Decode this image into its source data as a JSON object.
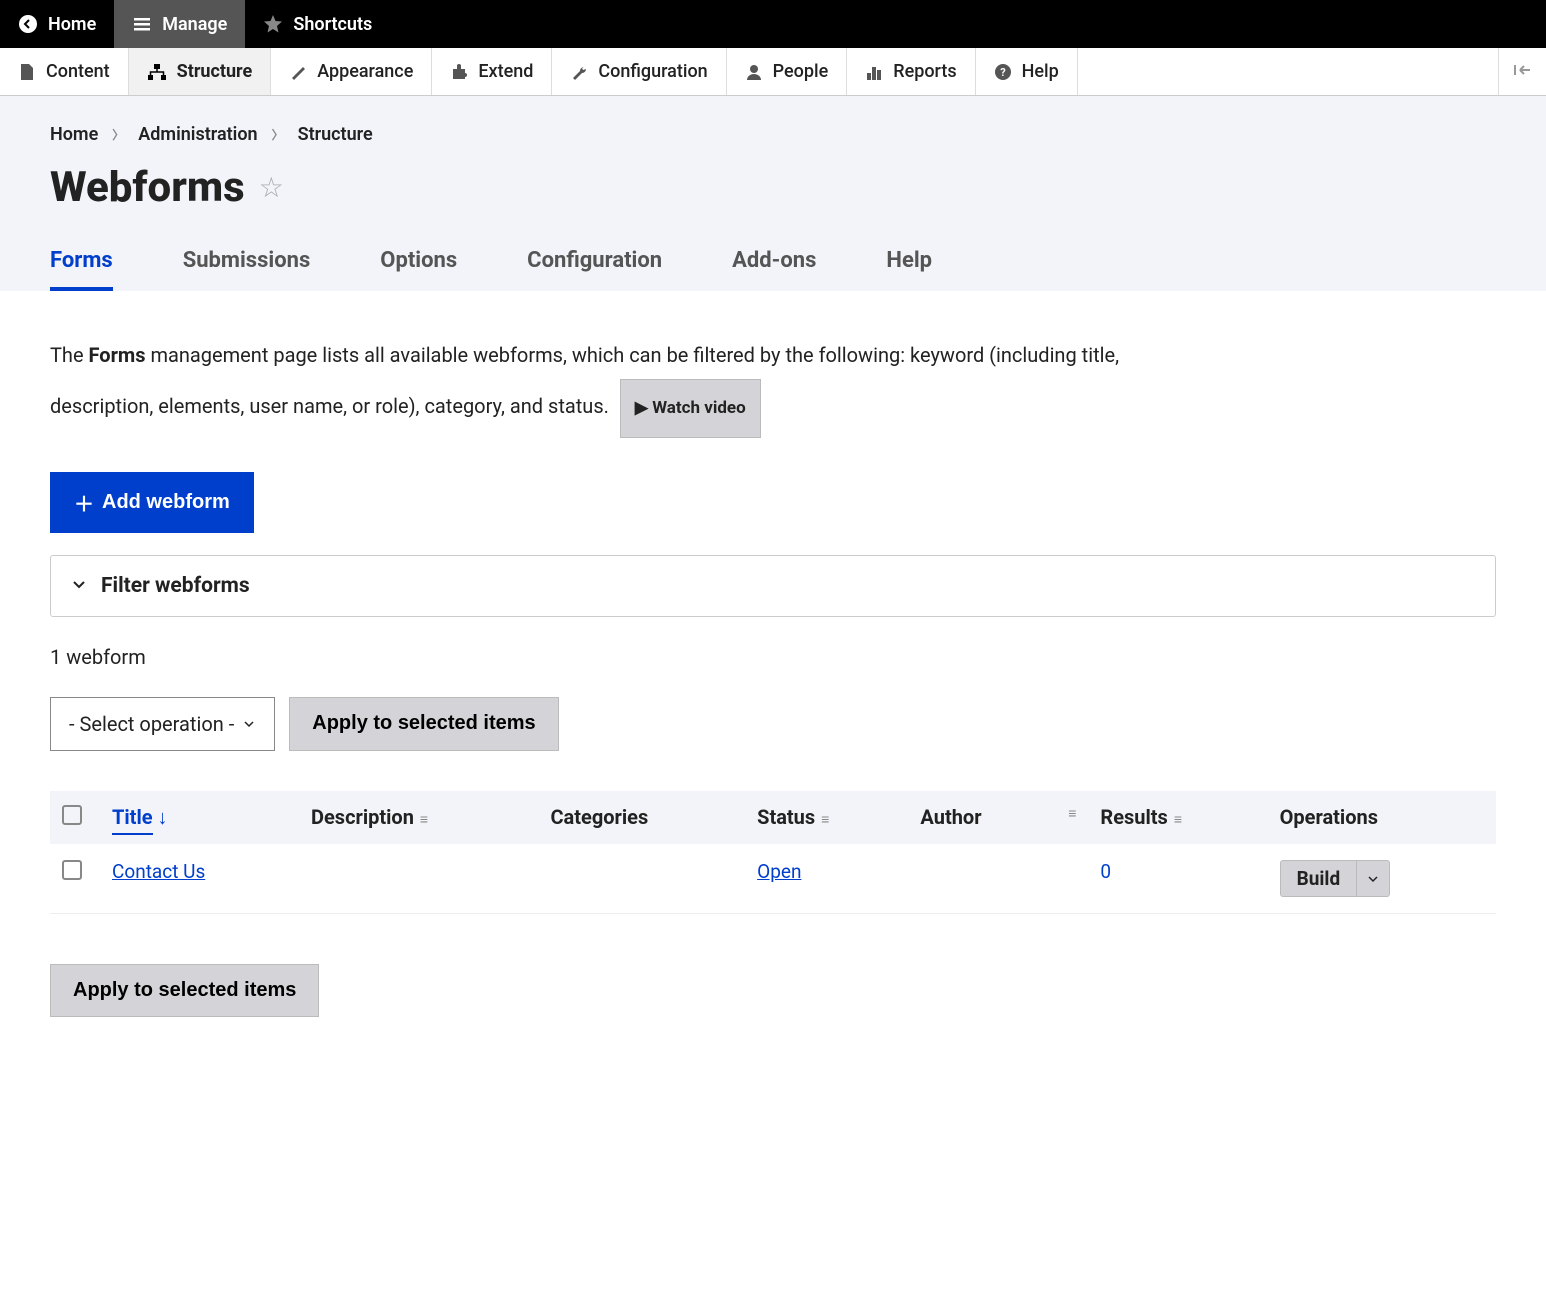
{
  "toolbar": {
    "home": "Home",
    "manage": "Manage",
    "shortcuts": "Shortcuts"
  },
  "admin_menu": {
    "content": "Content",
    "structure": "Structure",
    "appearance": "Appearance",
    "extend": "Extend",
    "configuration": "Configuration",
    "people": "People",
    "reports": "Reports",
    "help": "Help"
  },
  "breadcrumb": {
    "home": "Home",
    "admin": "Administration",
    "structure": "Structure"
  },
  "page_title": "Webforms",
  "tabs": {
    "forms": "Forms",
    "submissions": "Submissions",
    "options": "Options",
    "configuration": "Configuration",
    "addons": "Add-ons",
    "help": "Help"
  },
  "description": {
    "prefix": "The ",
    "bold": "Forms",
    "rest": " management page lists all available webforms, which can be filtered by the following: keyword (including title, description, elements, user name, or role), category, and status."
  },
  "watch_video": "▶ Watch video",
  "add_webform": "Add webform",
  "filter_label": "Filter webforms",
  "count": "1 webform",
  "select_operation": "- Select operation -",
  "apply_selected": "Apply to selected items",
  "columns": {
    "title": "Title",
    "description": "Description",
    "categories": "Categories",
    "status": "Status",
    "author": "Author",
    "results": "Results",
    "operations": "Operations"
  },
  "rows": [
    {
      "title": "Contact Us",
      "description": "",
      "categories": "",
      "status": "Open",
      "author": "",
      "results": "0",
      "op": "Build"
    }
  ]
}
